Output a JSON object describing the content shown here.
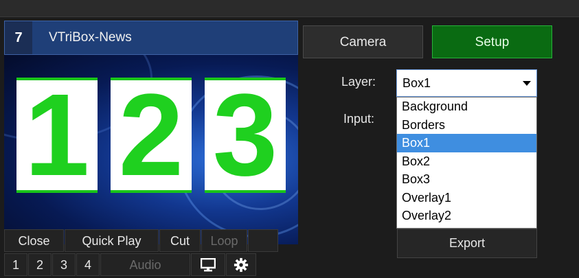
{
  "panel": {
    "number": "7",
    "title": "VTriBox-News",
    "preview_boxes": [
      "1",
      "2",
      "3"
    ]
  },
  "controls": {
    "row1": [
      "Close",
      "Quick Play",
      "Cut",
      "Loop"
    ],
    "row2_numbers": [
      "1",
      "2",
      "3",
      "4"
    ],
    "audio_label": "Audio",
    "icons": [
      "monitor-icon",
      "gear-icon"
    ]
  },
  "right": {
    "camera_label": "Camera",
    "setup_label": "Setup",
    "layer_label": "Layer:",
    "input_label": "Input:",
    "layer_value": "Box1",
    "layer_options": [
      "Background",
      "Borders",
      "Box1",
      "Box2",
      "Box3",
      "Overlay1",
      "Overlay2"
    ],
    "selected_option": "Box1",
    "export_label": "Export"
  },
  "colors": {
    "accent_green": "#0a6b12",
    "header_blue": "#1f3f78",
    "digit_green": "#1fd01f",
    "selection_blue": "#3f8ee0"
  }
}
